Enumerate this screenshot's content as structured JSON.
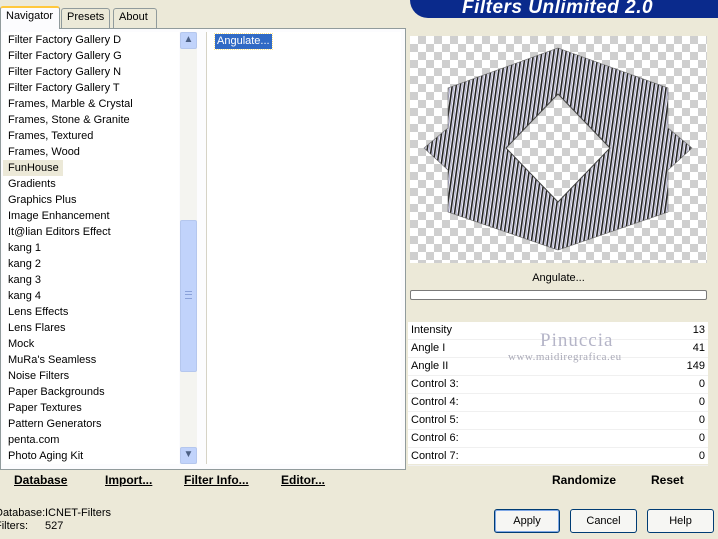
{
  "tabs": [
    {
      "label": "Navigator",
      "active": true
    },
    {
      "label": "Presets",
      "active": false
    },
    {
      "label": "About",
      "active": false
    }
  ],
  "banner": {
    "title": "Filters Unlimited 2.0",
    "color": "#0a2a8c"
  },
  "categories": [
    "Filter Factory Gallery D",
    "Filter Factory Gallery G",
    "Filter Factory Gallery N",
    "Filter Factory Gallery T",
    "Frames, Marble & Crystal",
    "Frames, Stone & Granite",
    "Frames, Textured",
    "Frames, Wood",
    "FunHouse",
    "Gradients",
    "Graphics Plus",
    "Image Enhancement",
    "It@lian Editors Effect",
    "kang 1",
    "kang 2",
    "kang 3",
    "kang 4",
    "Lens Effects",
    "Lens Flares",
    "Mock",
    "MuRa's Seamless",
    "Noise Filters",
    "Paper Backgrounds",
    "Paper Textures",
    "Pattern Generators",
    "penta.com",
    "Photo Aging Kit"
  ],
  "selected_category": "FunHouse",
  "filters": [
    "Angulate..."
  ],
  "selected_filter": "Angulate...",
  "preview": {
    "filter_name": "Angulate..."
  },
  "parameters": [
    {
      "label": "Intensity",
      "value": "13"
    },
    {
      "label": "Angle I",
      "value": "41"
    },
    {
      "label": "Angle II",
      "value": "149"
    },
    {
      "label": "Control 3:",
      "value": "0"
    },
    {
      "label": "Control 4:",
      "value": "0"
    },
    {
      "label": "Control 5:",
      "value": "0"
    },
    {
      "label": "Control 6:",
      "value": "0"
    },
    {
      "label": "Control 7:",
      "value": "0"
    }
  ],
  "watermark": {
    "title": "Pinuccia",
    "subtitle": "www.maidiregrafica.eu"
  },
  "toolbar": {
    "database": "Database",
    "import": "Import...",
    "filter_info": "Filter Info...",
    "editor": "Editor...",
    "randomize": "Randomize",
    "reset": "Reset"
  },
  "status": {
    "database_label": "Database:",
    "database_value": "ICNET-Filters",
    "filters_label": "Filters:",
    "filters_value": "527"
  },
  "buttons": {
    "apply": "Apply",
    "cancel": "Cancel",
    "help": "Help"
  }
}
